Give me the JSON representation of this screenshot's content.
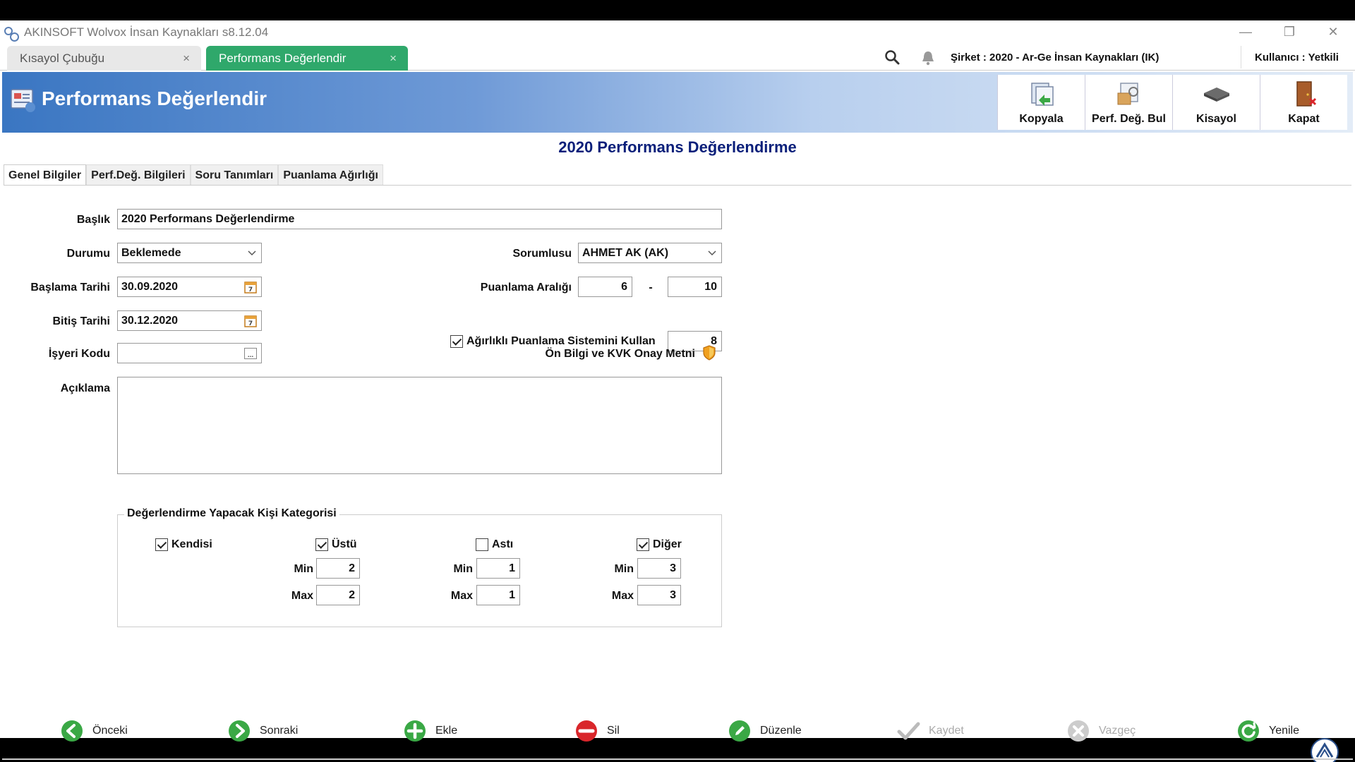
{
  "window": {
    "title": "AKINSOFT Wolvox İnsan Kaynakları s8.12.04",
    "controls": [
      "—",
      "❐",
      "✕"
    ]
  },
  "tabs": [
    {
      "label": "Kısayol Çubuğu",
      "close": "×"
    },
    {
      "label": "Performans Değerlendir",
      "close": "×"
    }
  ],
  "topbar": {
    "sirket": "Şirket : 2020 - Ar-Ge İnsan Kaynakları (IK)",
    "kullanici": "Kullanıcı : Yetkili"
  },
  "header": {
    "title": "Performans Değerlendir",
    "toolbar": [
      {
        "label": "Kopyala",
        "icon": "copy-icon"
      },
      {
        "label": "Perf. Değ. Bul",
        "icon": "find-icon"
      },
      {
        "label": "Kisayol",
        "icon": "shortcut-icon"
      },
      {
        "label": "Kapat",
        "icon": "exit-door-icon"
      }
    ]
  },
  "form_title": "2020 Performans Değerlendirme",
  "subtabs": [
    "Genel Bilgiler",
    "Perf.Değ. Bilgileri",
    "Soru Tanımları",
    "Puanlama Ağırlığı"
  ],
  "form": {
    "baslik_label": "Başlık",
    "baslik_value": "2020 Performans Değerlendirme",
    "durumu_label": "Durumu",
    "durumu_value": "Beklemede",
    "sorumlusu_label": "Sorumlusu",
    "sorumlusu_value": "AHMET AK (AK)",
    "baslama_label": "Başlama Tarihi",
    "baslama_value": "30.09.2020",
    "puanlama_label": "Puanlama Aralığı",
    "puanlama_min": "6",
    "puanlama_sep": "-",
    "puanlama_max": "10",
    "bitis_label": "Bitiş Tarihi",
    "bitis_value": "30.12.2020",
    "agirlikli_label": "Ağırlıklı Puanlama Sistemini Kullan",
    "agirlikli_checked": true,
    "agirlikli_value": "8",
    "isyeri_label": "İşyeri Kodu",
    "isyeri_value": "",
    "onbilgi_label": "Ön Bilgi ve KVK Onay Metni",
    "aciklama_label": "Açıklama",
    "aciklama_value": ""
  },
  "group": {
    "title": "Değerlendirme Yapacak Kişi Kategorisi",
    "kendisi": {
      "label": "Kendisi",
      "checked": true
    },
    "ustu": {
      "label": "Üstü",
      "checked": true,
      "min": "2",
      "max": "2"
    },
    "asti": {
      "label": "Astı",
      "checked": false,
      "min": "1",
      "max": "1"
    },
    "diger": {
      "label": "Diğer",
      "checked": true,
      "min": "3",
      "max": "3"
    },
    "min_label": "Min",
    "max_label": "Max"
  },
  "nav": [
    {
      "label": "Önceki",
      "icon": "arrow-left-icon",
      "color": "#3aa845"
    },
    {
      "label": "Sonraki",
      "icon": "arrow-right-icon",
      "color": "#3aa845"
    },
    {
      "label": "Ekle",
      "icon": "plus-icon",
      "color": "#3aa845"
    },
    {
      "label": "Sil",
      "icon": "minus-icon",
      "color": "#d9262b"
    },
    {
      "label": "Düzenle",
      "icon": "edit-icon",
      "color": "#3aa845"
    },
    {
      "label": "Kaydet",
      "icon": "check-icon",
      "color": "#bbbbbb"
    },
    {
      "label": "Vazgeç",
      "icon": "cancel-icon",
      "color": "#bbbbbb"
    },
    {
      "label": "Yenile",
      "icon": "refresh-icon",
      "color": "#3aa845"
    }
  ],
  "colors": {
    "accent_tab": "#2fa86b",
    "header_blue": "#3a76c2",
    "form_title": "#0a1f7a"
  }
}
